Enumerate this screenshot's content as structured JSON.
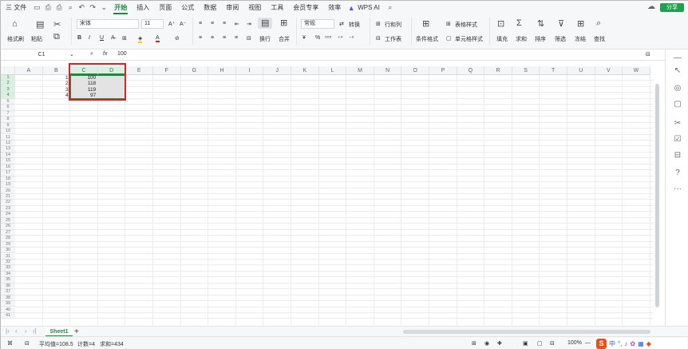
{
  "menubar": {
    "file": "三 文件",
    "tabs": [
      {
        "label": "开始",
        "active": true
      },
      {
        "label": "插入"
      },
      {
        "label": "页面"
      },
      {
        "label": "公式"
      },
      {
        "label": "数据"
      },
      {
        "label": "审阅"
      },
      {
        "label": "视图"
      },
      {
        "label": "工具"
      },
      {
        "label": "会员专享"
      },
      {
        "label": "效率"
      },
      {
        "label": "WPS AI"
      }
    ],
    "share": "分享"
  },
  "ribbon": {
    "format_painter": "格式刷",
    "paste": "粘贴",
    "font_name": "宋体",
    "font_size": "11",
    "wrap": "换行",
    "merge": "合并",
    "number_format": "常规",
    "convert": "转换",
    "rows_cols": "行和列",
    "worksheet": "工作表",
    "cond_format": "条件格式",
    "table_style": "表格样式",
    "cell_style": "单元格样式",
    "fill": "填充",
    "sum": "求和",
    "sort": "排序",
    "filter": "筛选",
    "freeze": "冻结",
    "find": "查找"
  },
  "formula_bar": {
    "cell_ref": "C1",
    "fx": "fx",
    "value": "100"
  },
  "columns": [
    "A",
    "B",
    "C",
    "D",
    "E",
    "F",
    "G",
    "H",
    "I",
    "J",
    "K",
    "L",
    "M",
    "N",
    "O",
    "P",
    "Q",
    "R",
    "S",
    "T",
    "U",
    "V",
    "W"
  ],
  "rows": [
    "1",
    "2",
    "3",
    "4",
    "5",
    "6",
    "7",
    "8",
    "9",
    "10",
    "11",
    "12",
    "13",
    "14",
    "15",
    "16",
    "17",
    "18",
    "19",
    "20",
    "21",
    "22",
    "23",
    "24",
    "25",
    "26",
    "27",
    "28",
    "29",
    "30",
    "31",
    "32",
    "33",
    "34",
    "35",
    "36",
    "37",
    "38",
    "39",
    "40",
    "41"
  ],
  "cells": {
    "b1": "1",
    "b2": "2",
    "b3": "3",
    "b4": "4",
    "c1": "100",
    "c2": "118",
    "c3": "119",
    "c4": "97"
  },
  "sheets": {
    "active": "Sheet1",
    "add": "+"
  },
  "status": {
    "average": "平均值=108.5",
    "count": "计数=4",
    "sum": "求和=434",
    "zoom": "100%",
    "ime": "中"
  }
}
